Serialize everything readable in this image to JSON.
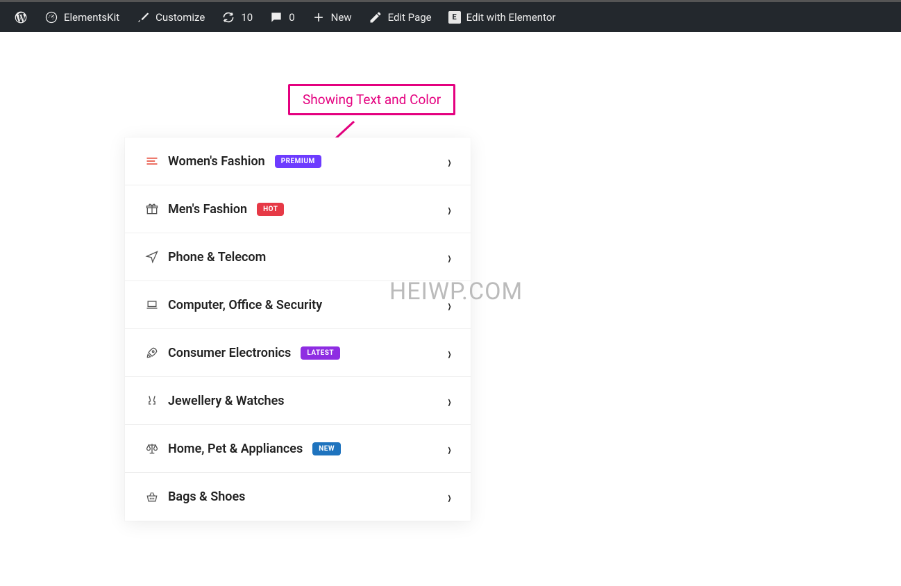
{
  "topbar": {
    "elementskit": "ElementsKit",
    "customize": "Customize",
    "updates_count": "10",
    "comments_count": "0",
    "new": "New",
    "edit_page": "Edit Page",
    "edit_elementor": "Edit with Elementor"
  },
  "annotation": {
    "label": "Showing Text and Color"
  },
  "watermark": "HEIWP.COM",
  "categories": [
    {
      "icon": "menu-lines",
      "label": "Women's Fashion",
      "badge": {
        "text": "PREMIUM",
        "bg": "#6d3bff"
      },
      "icon_color": "#e74c3c"
    },
    {
      "icon": "gift",
      "label": "Men's Fashion",
      "badge": {
        "text": "HOT",
        "bg": "#e63946"
      }
    },
    {
      "icon": "paper-plane",
      "label": "Phone & Telecom",
      "badge": null
    },
    {
      "icon": "laptop",
      "label": "Computer, Office & Security",
      "badge": null
    },
    {
      "icon": "rocket",
      "label": "Consumer Electronics",
      "badge": {
        "text": "LATEST",
        "bg": "#8e2de2"
      }
    },
    {
      "icon": "cheers",
      "label": "Jewellery & Watches",
      "badge": null
    },
    {
      "icon": "scale",
      "label": "Home, Pet & Appliances",
      "badge": {
        "text": "NEW",
        "bg": "#1e73be"
      }
    },
    {
      "icon": "basket",
      "label": "Bags & Shoes",
      "badge": null
    }
  ]
}
